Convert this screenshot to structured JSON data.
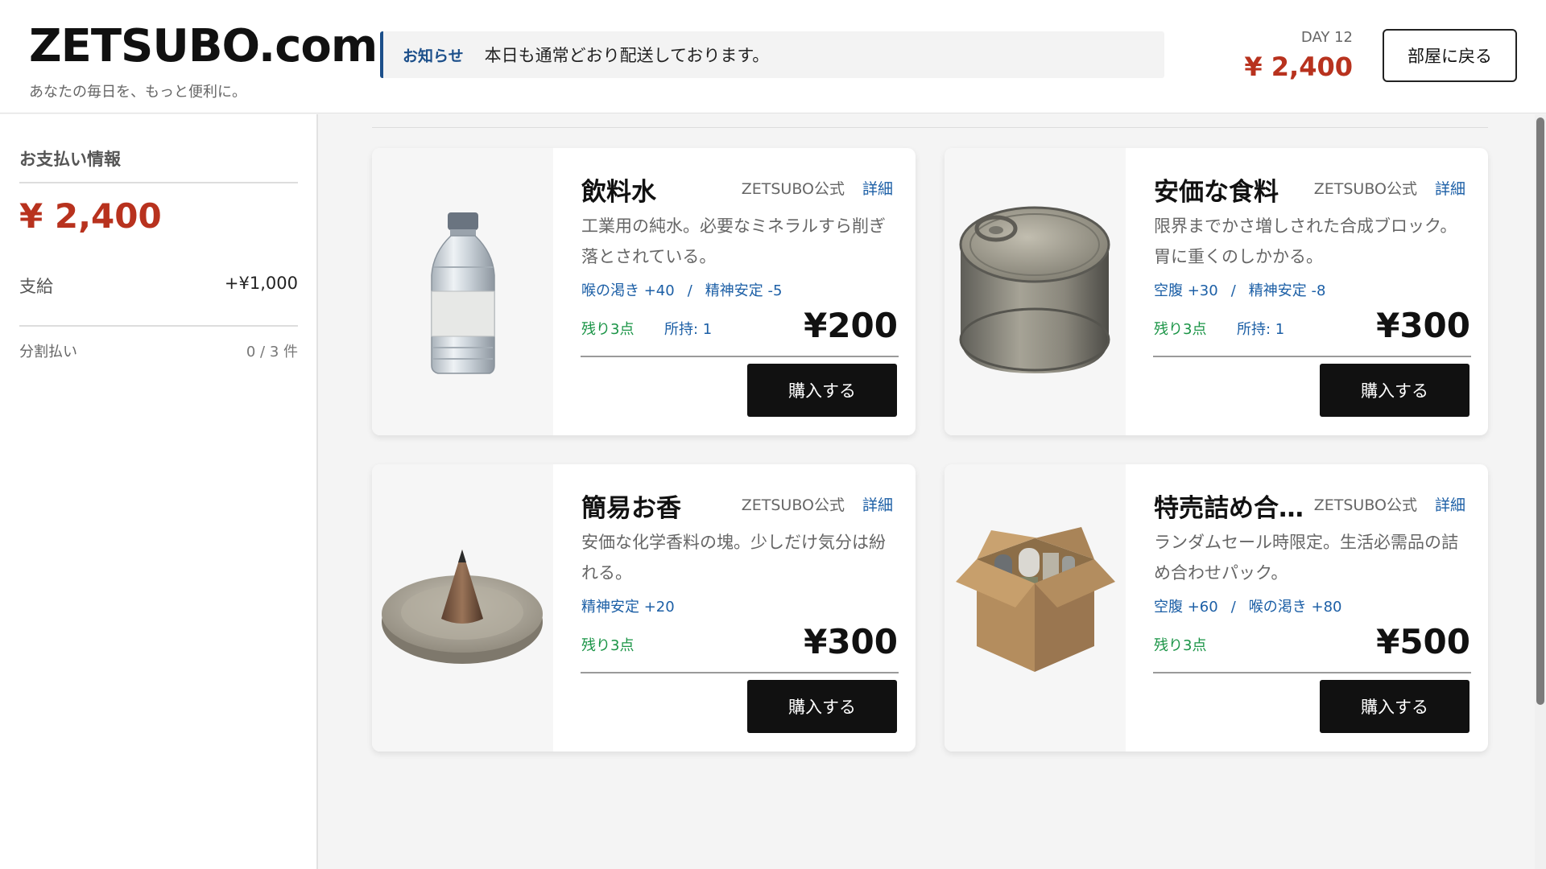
{
  "header": {
    "logo": "ZETSUBO.com",
    "tagline": "あなたの毎日を、もっと便利に。",
    "notice_label": "お知らせ",
    "notice_text": "本日も通常どおり配送しております。",
    "day": "DAY 12",
    "balance": "¥ 2,400",
    "back_button": "部屋に戻る"
  },
  "sidebar": {
    "title": "お支払い情報",
    "balance": "¥ 2,400",
    "allowance_label": "支給",
    "allowance_value": "+¥1,000",
    "installment_label": "分割払い",
    "installment_value": "0 / 3 件"
  },
  "products": [
    {
      "name": "飲料水",
      "vendor": "ZETSUBO公式",
      "detail": "詳細",
      "desc": "工業用の純水。必要なミネラルすら削ぎ落とされている。",
      "effect1": "喉の渇き +40",
      "effect_sep": "/",
      "effect2": "精神安定 -5",
      "stock": "残り3点",
      "owned": "所持: 1",
      "price": "¥200",
      "buy": "購入する",
      "icon": "water-bottle-icon"
    },
    {
      "name": "安価な食料",
      "vendor": "ZETSUBO公式",
      "detail": "詳細",
      "desc": "限界までかさ増しされた合成ブロック。胃に重くのしかかる。",
      "effect1": "空腹 +30",
      "effect_sep": "/",
      "effect2": "精神安定 -8",
      "stock": "残り3点",
      "owned": "所持: 1",
      "price": "¥300",
      "buy": "購入する",
      "icon": "tin-can-icon"
    },
    {
      "name": "簡易お香",
      "vendor": "ZETSUBO公式",
      "detail": "詳細",
      "desc": "安価な化学香料の塊。少しだけ気分は紛れる。",
      "effect1": "精神安定 +20",
      "stock": "残り3点",
      "price": "¥300",
      "buy": "購入する",
      "icon": "incense-cone-icon"
    },
    {
      "name": "特売詰め合…",
      "vendor": "ZETSUBO公式",
      "detail": "詳細",
      "desc": "ランダムセール時限定。生活必需品の詰め合わせパック。",
      "effect1": "空腹 +60",
      "effect_sep": "/",
      "effect2": "喉の渇き +80",
      "stock": "残り3点",
      "price": "¥500",
      "buy": "購入する",
      "icon": "cardboard-box-icon"
    }
  ]
}
